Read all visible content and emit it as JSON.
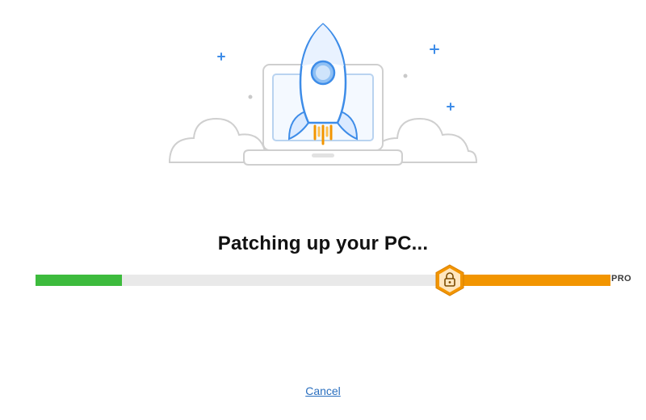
{
  "heading": "Patching up your PC...",
  "progress": {
    "green_percent": 15,
    "orange_percent": 28
  },
  "pro_label": "PRO",
  "cancel_label": "Cancel",
  "colors": {
    "green": "#3dbb3d",
    "orange": "#f29500",
    "track": "#e9e9e9",
    "link": "#2a6fbf"
  }
}
